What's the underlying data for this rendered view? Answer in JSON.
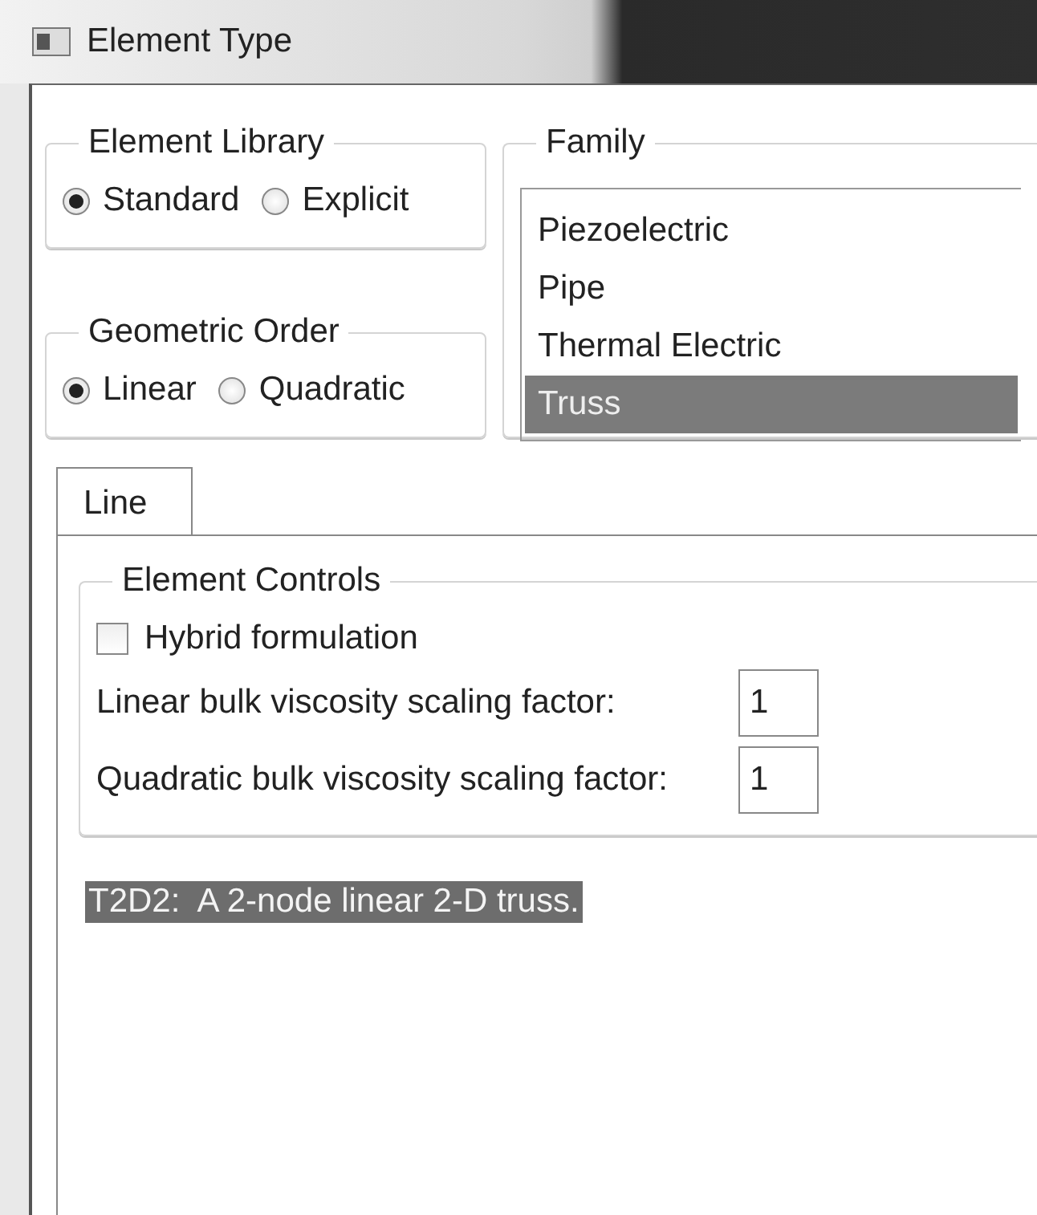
{
  "window": {
    "title": "Element Type"
  },
  "element_library": {
    "title": "Element Library",
    "options": [
      {
        "label": "Standard",
        "selected": true
      },
      {
        "label": "Explicit",
        "selected": false
      }
    ]
  },
  "geometric_order": {
    "title": "Geometric Order",
    "options": [
      {
        "label": "Linear",
        "selected": true
      },
      {
        "label": "Quadratic",
        "selected": false
      }
    ]
  },
  "family": {
    "title": "Family",
    "items": [
      {
        "label": "Piezoelectric",
        "selected": false
      },
      {
        "label": "Pipe",
        "selected": false
      },
      {
        "label": "Thermal Electric",
        "selected": false
      },
      {
        "label": "Truss",
        "selected": true
      }
    ]
  },
  "tabs": [
    {
      "label": "Line",
      "selected": true
    }
  ],
  "element_controls": {
    "title": "Element Controls",
    "hybrid_formulation": {
      "label": "Hybrid formulation",
      "checked": false
    },
    "fields": [
      {
        "label": "Linear bulk viscosity scaling factor:",
        "value": "1"
      },
      {
        "label": "Quadratic bulk viscosity scaling factor:",
        "value": "1"
      }
    ]
  },
  "description": "T2D2:  A 2-node linear 2-D truss."
}
